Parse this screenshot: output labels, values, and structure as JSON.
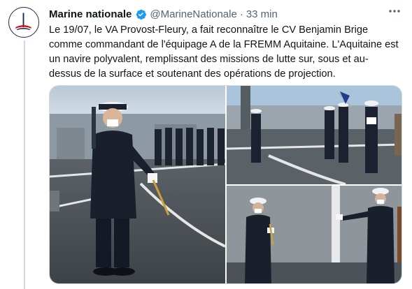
{
  "account": {
    "display_name": "Marine nationale",
    "handle": "@MarineNationale",
    "separator": "·",
    "timestamp": "33 min",
    "verified": true
  },
  "tweet": {
    "text": "Le 19/07, le VA Provost-Fleury, a fait reconnaître le CV Benjamin Brige comme commandant de l'équipage A de la FREMM Aquitaine. L'Aquitaine est un navire polyvalent, remplissant des missions de lutte sur, sous et au-dessus de la surface et soutenant des opérations de projection."
  },
  "icons": {
    "verified": "verified-badge-icon",
    "more": "more-options-icon",
    "avatar": "marine-nationale-logo"
  },
  "media": {
    "count": 3,
    "photos": [
      {
        "description": "photo-ceremony-deck-officer-saluting"
      },
      {
        "description": "photo-crew-and-flag-on-deck"
      },
      {
        "description": "photo-two-officers-facing"
      }
    ]
  },
  "colors": {
    "verified": "#1d9bf0",
    "secondary_text": "#536471",
    "border": "#cfd9de",
    "navy": "#1b2a4a"
  }
}
